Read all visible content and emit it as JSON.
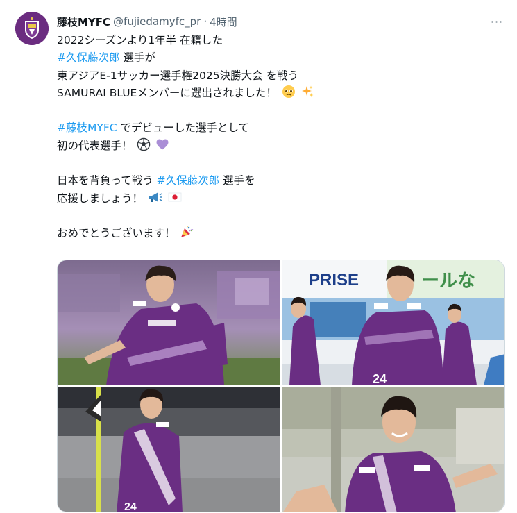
{
  "tweet": {
    "display_name": "藤枝MYFC",
    "handle": "@fujiedamyfc_pr",
    "separator": "·",
    "time": "4時間",
    "more_label": "···",
    "lines": {
      "l1": "2022シーズンより1年半 在籍した",
      "l2_tag": "#久保藤次郎",
      "l2_rest": " 選手が",
      "l3": "東アジアE-1サッカー選手権2025決勝大会 を戦う",
      "l4": "SAMURAI BLUEメンバーに選出されました！",
      "l5_tag": "#藤枝MYFC",
      "l5_rest": " でデビューした選手として",
      "l6": "初の代表選手！",
      "l7_pre": "日本を背負って戦う ",
      "l7_tag": "#久保藤次郎",
      "l7_rest": " 選手を",
      "l8": "応援しましょう！",
      "l9": "おめでとうございます！"
    },
    "photos": {
      "p2_banner": "PRISE",
      "p2_sign": "ールな",
      "p2_number": "24",
      "p3_number": "24"
    }
  },
  "colors": {
    "link": "#1d9bf0",
    "text": "#0f1419",
    "muted": "#536471",
    "club_purple": "#6b2c80"
  },
  "icons": {
    "avatar": "club-crest-icon",
    "more": "more-options-icon",
    "emojis": [
      "pleading-face-icon",
      "sparkles-icon",
      "soccer-ball-icon",
      "purple-heart-icon",
      "megaphone-icon",
      "japan-flag-icon",
      "party-popper-icon"
    ]
  }
}
